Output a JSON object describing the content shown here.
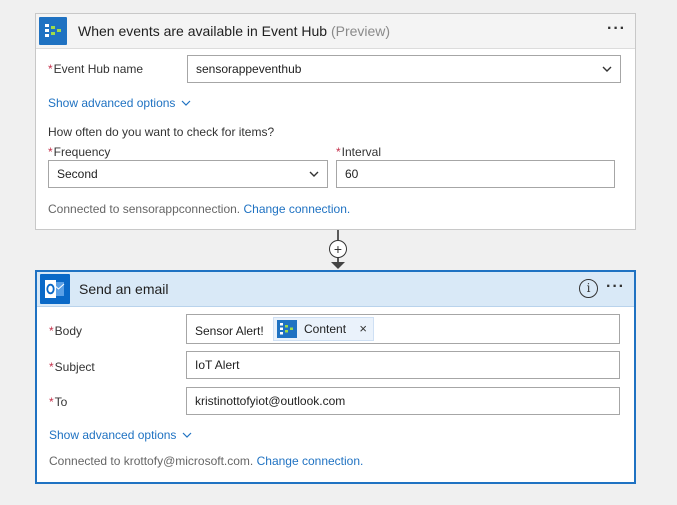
{
  "trigger": {
    "title": "When events are available in Event Hub",
    "preview": "(Preview)",
    "menu": "···",
    "event_hub": {
      "label": "Event Hub name",
      "value": "sensorappeventhub"
    },
    "show_advanced": "Show advanced options",
    "question": "How often do you want to check for items?",
    "frequency": {
      "label": "Frequency",
      "value": "Second"
    },
    "interval": {
      "label": "Interval",
      "value": "60"
    },
    "connected_text": "Connected to sensorappconnection.",
    "change_connection": "Change connection."
  },
  "connector": {
    "plus": "+"
  },
  "action": {
    "title": "Send an email",
    "info": "i",
    "menu": "···",
    "body": {
      "label": "Body",
      "text": "Sensor Alert!",
      "token": "Content",
      "token_remove": "×"
    },
    "subject": {
      "label": "Subject",
      "value": "IoT Alert"
    },
    "to": {
      "label": "To",
      "value": "kristinottofyiot@outlook.com"
    },
    "show_advanced": "Show advanced options",
    "connected_text": "Connected to krottofy@microsoft.com.",
    "change_connection": "Change connection."
  },
  "colors": {
    "accent": "#1f72c2",
    "required": "#c4314b",
    "event_hub_icon_bg": "#1f72c2",
    "outlook_icon_bg": "#0a69c7"
  },
  "icons": {
    "event_hub": "event-hub-icon",
    "outlook": "outlook-icon",
    "chevron": "chevron-down-icon",
    "more": "more-icon",
    "info": "info-icon",
    "add": "add-step-icon"
  }
}
